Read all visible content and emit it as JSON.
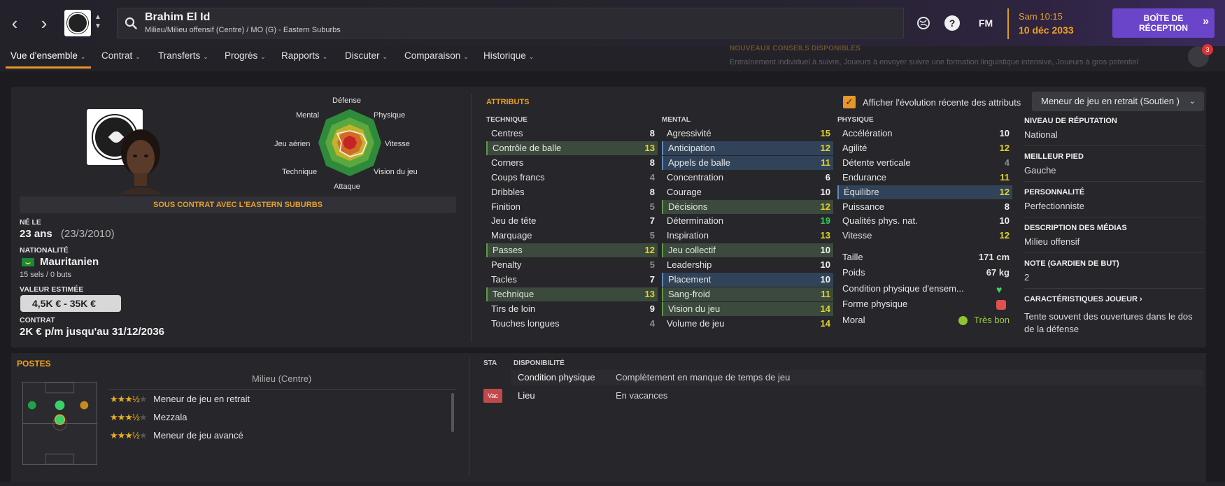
{
  "header": {
    "player_name": "Brahim El Id",
    "player_subtitle": "Milieu/Milieu offensif (Centre) / MO (G) - Eastern Suburbs",
    "fm_label": "FM",
    "help_label": "?",
    "time": "Sam 10:15",
    "date": "10 déc 2033",
    "inbox_line1": "BOÎTE DE",
    "inbox_line2": "RÉCEPTION",
    "accent_color": "#6a45c9"
  },
  "tabs": [
    {
      "label": "Vue d'ensemble"
    },
    {
      "label": "Contrat"
    },
    {
      "label": "Transferts"
    },
    {
      "label": "Progrès"
    },
    {
      "label": "Rapports"
    },
    {
      "label": "Discuter"
    },
    {
      "label": "Comparaison"
    },
    {
      "label": "Historique"
    }
  ],
  "advice": {
    "title": "NOUVEAUX CONSEILS DISPONIBLES",
    "text": "Entraînement individuel à suivre, Joueurs à envoyer suivre une formation linguistique intensive, Joueurs à gros potentiel"
  },
  "notifications": {
    "count": "3"
  },
  "profile": {
    "contract_banner": "SOUS CONTRAT AVEC L'EASTERN SUBURBS",
    "born_label": "NÉ LE",
    "age": "23 ans",
    "birthdate": "(23/3/2010)",
    "nationality_label": "NATIONALITÉ",
    "nationality": "Mauritanien",
    "caps": "15 sels / 0 buts",
    "value_label": "VALEUR ESTIMÉE",
    "value": "4,5K € - 35K €",
    "contract_label": "CONTRAT",
    "contract": "2K € p/m jusqu'au 31/12/2036"
  },
  "radar": {
    "labels": {
      "top": "Défense",
      "top_left": "Mental",
      "top_right": "Physique",
      "left": "Jeu aérien",
      "right": "Vitesse",
      "bottom_left": "Technique",
      "bottom_right": "Vision du jeu",
      "bottom": "Attaque"
    }
  },
  "attributes": {
    "title": "ATTRIBUTS",
    "show_recent_label": "Afficher l'évolution récente des attributs",
    "show_recent_checked": true,
    "role_select": "Meneur de jeu en retrait (Soutien )",
    "technique_head": "TECHNIQUE",
    "mental_head": "MENTAL",
    "physique_head": "PHYSIQUE",
    "technique": [
      {
        "name": "Centres",
        "value": "8",
        "hl": "",
        "tone": "white"
      },
      {
        "name": "Contrôle de balle",
        "value": "13",
        "hl": "g",
        "tone": "yellow"
      },
      {
        "name": "Corners",
        "value": "8",
        "hl": "",
        "tone": "white"
      },
      {
        "name": "Coups francs",
        "value": "4",
        "hl": "",
        "tone": "gray"
      },
      {
        "name": "Dribbles",
        "value": "8",
        "hl": "",
        "tone": "white"
      },
      {
        "name": "Finition",
        "value": "5",
        "hl": "",
        "tone": "gray"
      },
      {
        "name": "Jeu de tête",
        "value": "7",
        "hl": "",
        "tone": "white"
      },
      {
        "name": "Marquage",
        "value": "5",
        "hl": "",
        "tone": "gray"
      },
      {
        "name": "Passes",
        "value": "12",
        "hl": "g",
        "tone": "yellow"
      },
      {
        "name": "Penalty",
        "value": "5",
        "hl": "",
        "tone": "gray"
      },
      {
        "name": "Tacles",
        "value": "7",
        "hl": "",
        "tone": "white"
      },
      {
        "name": "Technique",
        "value": "13",
        "hl": "g",
        "tone": "yellow"
      },
      {
        "name": "Tirs de loin",
        "value": "9",
        "hl": "",
        "tone": "white"
      },
      {
        "name": "Touches longues",
        "value": "4",
        "hl": "",
        "tone": "gray"
      }
    ],
    "mental": [
      {
        "name": "Agressivité",
        "value": "15",
        "hl": "",
        "tone": "yellow"
      },
      {
        "name": "Anticipation",
        "value": "12",
        "hl": "b",
        "tone": "yellow"
      },
      {
        "name": "Appels de balle",
        "value": "11",
        "hl": "b",
        "tone": "yellow"
      },
      {
        "name": "Concentration",
        "value": "6",
        "hl": "",
        "tone": "white"
      },
      {
        "name": "Courage",
        "value": "10",
        "hl": "",
        "tone": "white"
      },
      {
        "name": "Décisions",
        "value": "12",
        "hl": "g",
        "tone": "yellow"
      },
      {
        "name": "Détermination",
        "value": "19",
        "hl": "",
        "tone": "green"
      },
      {
        "name": "Inspiration",
        "value": "13",
        "hl": "",
        "tone": "yellow"
      },
      {
        "name": "Jeu collectif",
        "value": "10",
        "hl": "g",
        "tone": "white"
      },
      {
        "name": "Leadership",
        "value": "10",
        "hl": "",
        "tone": "white"
      },
      {
        "name": "Placement",
        "value": "10",
        "hl": "b",
        "tone": "white"
      },
      {
        "name": "Sang-froid",
        "value": "11",
        "hl": "g",
        "tone": "yellow"
      },
      {
        "name": "Vision du jeu",
        "value": "14",
        "hl": "g",
        "tone": "yellow"
      },
      {
        "name": "Volume de jeu",
        "value": "14",
        "hl": "",
        "tone": "yellow"
      }
    ],
    "physique": [
      {
        "name": "Accélération",
        "value": "10",
        "hl": "",
        "tone": "white"
      },
      {
        "name": "Agilité",
        "value": "12",
        "hl": "",
        "tone": "yellow"
      },
      {
        "name": "Détente verticale",
        "value": "4",
        "hl": "",
        "tone": "gray"
      },
      {
        "name": "Endurance",
        "value": "11",
        "hl": "",
        "tone": "yellow"
      },
      {
        "name": "Équilibre",
        "value": "12",
        "hl": "b",
        "tone": "yellow"
      },
      {
        "name": "Puissance",
        "value": "8",
        "hl": "",
        "tone": "white"
      },
      {
        "name": "Qualités phys. nat.",
        "value": "10",
        "hl": "",
        "tone": "white"
      },
      {
        "name": "Vitesse",
        "value": "12",
        "hl": "",
        "tone": "yellow"
      }
    ],
    "height_label": "Taille",
    "height": "171 cm",
    "weight_label": "Poids",
    "weight": "67 kg",
    "condition_label": "Condition physique d'ensem...",
    "form_label": "Forme physique",
    "morale_label": "Moral",
    "morale": "Très bon"
  },
  "side_info": {
    "reputation_label": "NIVEAU DE RÉPUTATION",
    "reputation": "National",
    "foot_label": "MEILLEUR PIED",
    "foot": "Gauche",
    "personality_label": "PERSONNALITÉ",
    "personality": "Perfectionniste",
    "media_label": "DESCRIPTION DES MÉDIAS",
    "media": "Milieu offensif",
    "gk_label": "NOTE (GARDIEN DE BUT)",
    "gk": "2",
    "traits_label": "CARACTÉRISTIQUES JOUEUR",
    "traits": "Tente souvent des ouvertures dans le dos de la défense"
  },
  "positions": {
    "title": "POSTES",
    "current": "Milieu (Centre)",
    "roles": [
      {
        "name": "Meneur de jeu en retrait",
        "stars": "★★★",
        "half": "½",
        "empty": "★"
      },
      {
        "name": "Mezzala",
        "stars": "★★★",
        "half": "½",
        "empty": "★"
      },
      {
        "name": "Meneur de jeu avancé",
        "stars": "★★★",
        "half": "½",
        "empty": "★"
      }
    ]
  },
  "availability": {
    "sta_head": "STA",
    "dispo_head": "DISPONIBILITÉ",
    "condition_key": "Condition physique",
    "condition_value": "Complètement en manque de temps de jeu",
    "place_key": "Lieu",
    "place_value": "En vacances",
    "vac_badge": "Vac"
  }
}
